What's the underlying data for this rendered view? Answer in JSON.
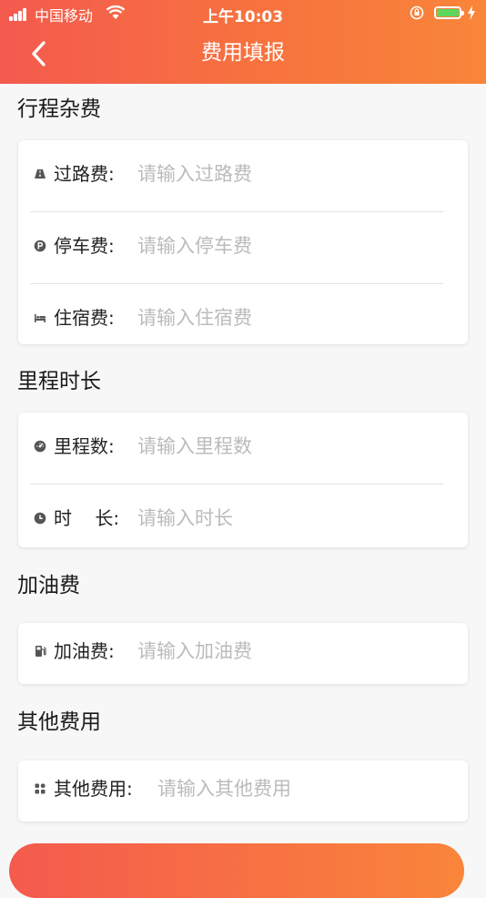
{
  "status_bar": {
    "carrier": "中国移动",
    "time": "上午10:03"
  },
  "nav": {
    "title": "费用填报"
  },
  "sections": [
    {
      "title": "行程杂费",
      "fields": [
        {
          "icon": "road-icon",
          "label": "过路费:",
          "placeholder": "请输入过路费",
          "value": ""
        },
        {
          "icon": "parking-icon",
          "label": "停车费:",
          "placeholder": "请输入停车费",
          "value": ""
        },
        {
          "icon": "bed-icon",
          "label": "住宿费:",
          "placeholder": "请输入住宿费",
          "value": ""
        }
      ]
    },
    {
      "title": "里程时长",
      "fields": [
        {
          "icon": "odometer-icon",
          "label": "里程数:",
          "placeholder": "请输入里程数",
          "value": ""
        },
        {
          "icon": "clock-icon",
          "label": "时    长:",
          "placeholder": "请输入时长",
          "value": ""
        }
      ]
    },
    {
      "title": "加油费",
      "fields": [
        {
          "icon": "fuel-icon",
          "label": "加油费:",
          "placeholder": "请输入加油费",
          "value": ""
        }
      ]
    },
    {
      "title": "其他费用",
      "fields": [
        {
          "icon": "grid-icon",
          "label": "其他费用:",
          "placeholder": "请输入其他费用",
          "value": ""
        }
      ]
    }
  ],
  "submit": {
    "label": ""
  },
  "colors": {
    "header_start": "#f45a4e",
    "header_end": "#f9853a",
    "placeholder": "#bbbbbb",
    "battery": "#5cd65c"
  }
}
